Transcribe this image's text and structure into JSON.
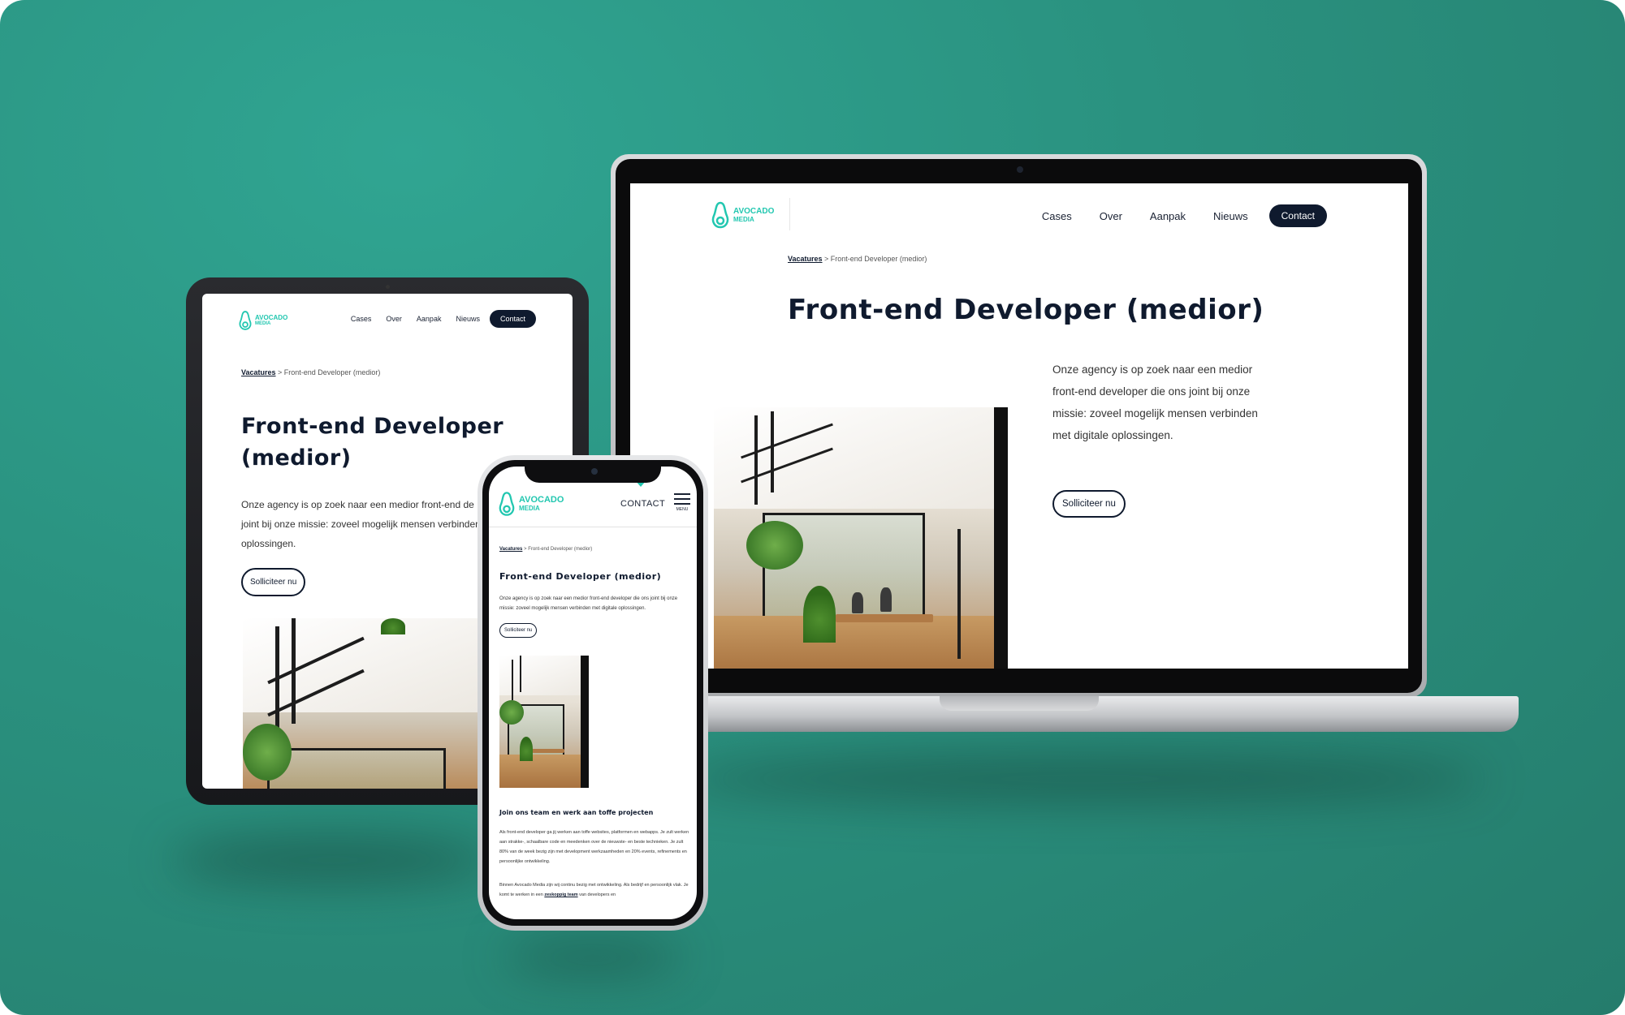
{
  "brand": {
    "line1": "AVOCADO",
    "line2": "MEDIA",
    "accent": "#22c7b0",
    "navy": "#0f1a2e",
    "background": "#2a917f"
  },
  "nav": {
    "items": [
      "Cases",
      "Over",
      "Aanpak",
      "Nieuws"
    ],
    "cta": "Contact"
  },
  "page": {
    "breadcrumb_link": "Vacatures",
    "breadcrumb_rest": " > Front-end Developer (medior)",
    "title": "Front-end Developer (medior)",
    "title_line1": "Front-end Developer",
    "title_line2": "(medior)",
    "intro_desktop": [
      "Onze agency is op zoek naar een medior",
      "front-end developer die ons joint bij onze",
      "missie: zoveel mogelijk mensen verbinden",
      "met digitale oplossingen."
    ],
    "intro_tablet": [
      "Onze agency is op zoek naar een medior front-end de",
      "joint bij onze missie: zoveel mogelijk mensen verbinden",
      "oplossingen."
    ],
    "intro_mobile": "Onze agency is op zoek naar een medior front-end developer die ons joint bij onze missie: zoveel mogelijk mensen verbinden met digitale oplossingen.",
    "apply": "Solliciteer nu"
  },
  "mobile": {
    "contact": "CONTACT",
    "menu": "MENU",
    "section_title": "Join ons team en werk aan toffe projecten",
    "para1": "Als front-end developer ga jij werken aan toffe websites, platformen en webapps. Je zult werken aan strakke-, schaalbare code en meedenken over de nieuwste- en beste technieken. Je zult 80% van de week bezig zijn met development werkzaamheden en 20% events, refinements en persoonlijke ontwikkeling.",
    "para2_start": "Binnen Avocado Media zijn wij continu bezig met ontwikkeling. Als bedrijf en persoonlijk vlak. Je komt te werken in een ",
    "para2_link": "zeskoppig team",
    "para2_end": " van developers en"
  }
}
